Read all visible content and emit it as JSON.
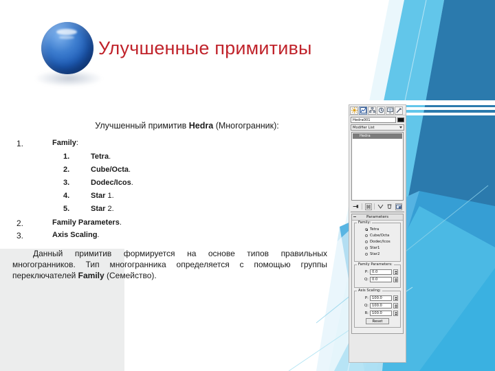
{
  "slide": {
    "title": "Улучшенные примитивы",
    "title_color": "#c0232b",
    "lead_prefix": "Улучшенный примитив ",
    "lead_bold": "Hedra",
    "lead_suffix": " (Многогранник):",
    "outline": [
      {
        "num": "1.",
        "label": "Family",
        "tail": ":",
        "sub": [
          {
            "num": "1.",
            "label": "Tetra",
            "tail": "."
          },
          {
            "num": "2.",
            "label": "Cube/Octa",
            "tail": "."
          },
          {
            "num": "3.",
            "label": "Dodec/Icos",
            "tail": "."
          },
          {
            "num": "4.",
            "label": "Star",
            "tail": " 1."
          },
          {
            "num": "5.",
            "label": "Star",
            "tail": " 2."
          }
        ]
      },
      {
        "num": "2.",
        "label": "Family Parameters",
        "tail": ".",
        "sub": []
      },
      {
        "num": "3.",
        "label": "Axis Scaling",
        "tail": ".",
        "sub": []
      }
    ],
    "paragraph_1": "Данный примитив формируется на основе типов правильных многогранников. Тип многогранника определяется с помощью группы переключателей ",
    "paragraph_bold": "Family",
    "paragraph_2": " (Семейство)."
  },
  "panel": {
    "tabs": [
      {
        "name": "create-tab",
        "icon": "sun-icon",
        "selected": false
      },
      {
        "name": "modify-tab",
        "icon": "modify-icon",
        "selected": true
      },
      {
        "name": "hierarchy-tab",
        "icon": "hierarchy-icon",
        "selected": false
      },
      {
        "name": "motion-tab",
        "icon": "motion-icon",
        "selected": false
      },
      {
        "name": "display-tab",
        "icon": "display-icon",
        "selected": false
      },
      {
        "name": "utilities-tab",
        "icon": "hammer-icon",
        "selected": false
      }
    ],
    "object_name": "Hedra001",
    "object_color": "#111111",
    "modifier_list_label": "Modifier List",
    "stack_items": [
      "Hedra"
    ],
    "stack_buttons": [
      "pin-stack-icon",
      "show-end-result-icon",
      "make-unique-icon",
      "remove-modifier-icon",
      "configure-modifier-sets-icon"
    ],
    "rollout": {
      "title": "Parameters",
      "family": {
        "label": "Family:",
        "options": [
          "Tetra",
          "Cube/Octa",
          "Dodec/Icos",
          "Star1",
          "Star2"
        ],
        "selected": "Tetra"
      },
      "family_parameters": {
        "label": "Family Parameters:",
        "fields": [
          {
            "label": "P:",
            "value": "0.0"
          },
          {
            "label": "Q:",
            "value": "0.0"
          }
        ]
      },
      "axis_scaling": {
        "label": "Axis Scaling:",
        "fields": [
          {
            "label": "P:",
            "value": "100.0"
          },
          {
            "label": "Q:",
            "value": "100.0"
          },
          {
            "label": "R:",
            "value": "100.0"
          }
        ],
        "reset_label": "Reset"
      }
    }
  },
  "decor": {
    "blue_dark": "#2b7aad",
    "blue_mid": "#3aa8dd",
    "blue_light": "#62c6ea",
    "blue_pale": "#a8dff3",
    "blue_faint": "#d6eff9",
    "band_color": "#ffffff"
  }
}
